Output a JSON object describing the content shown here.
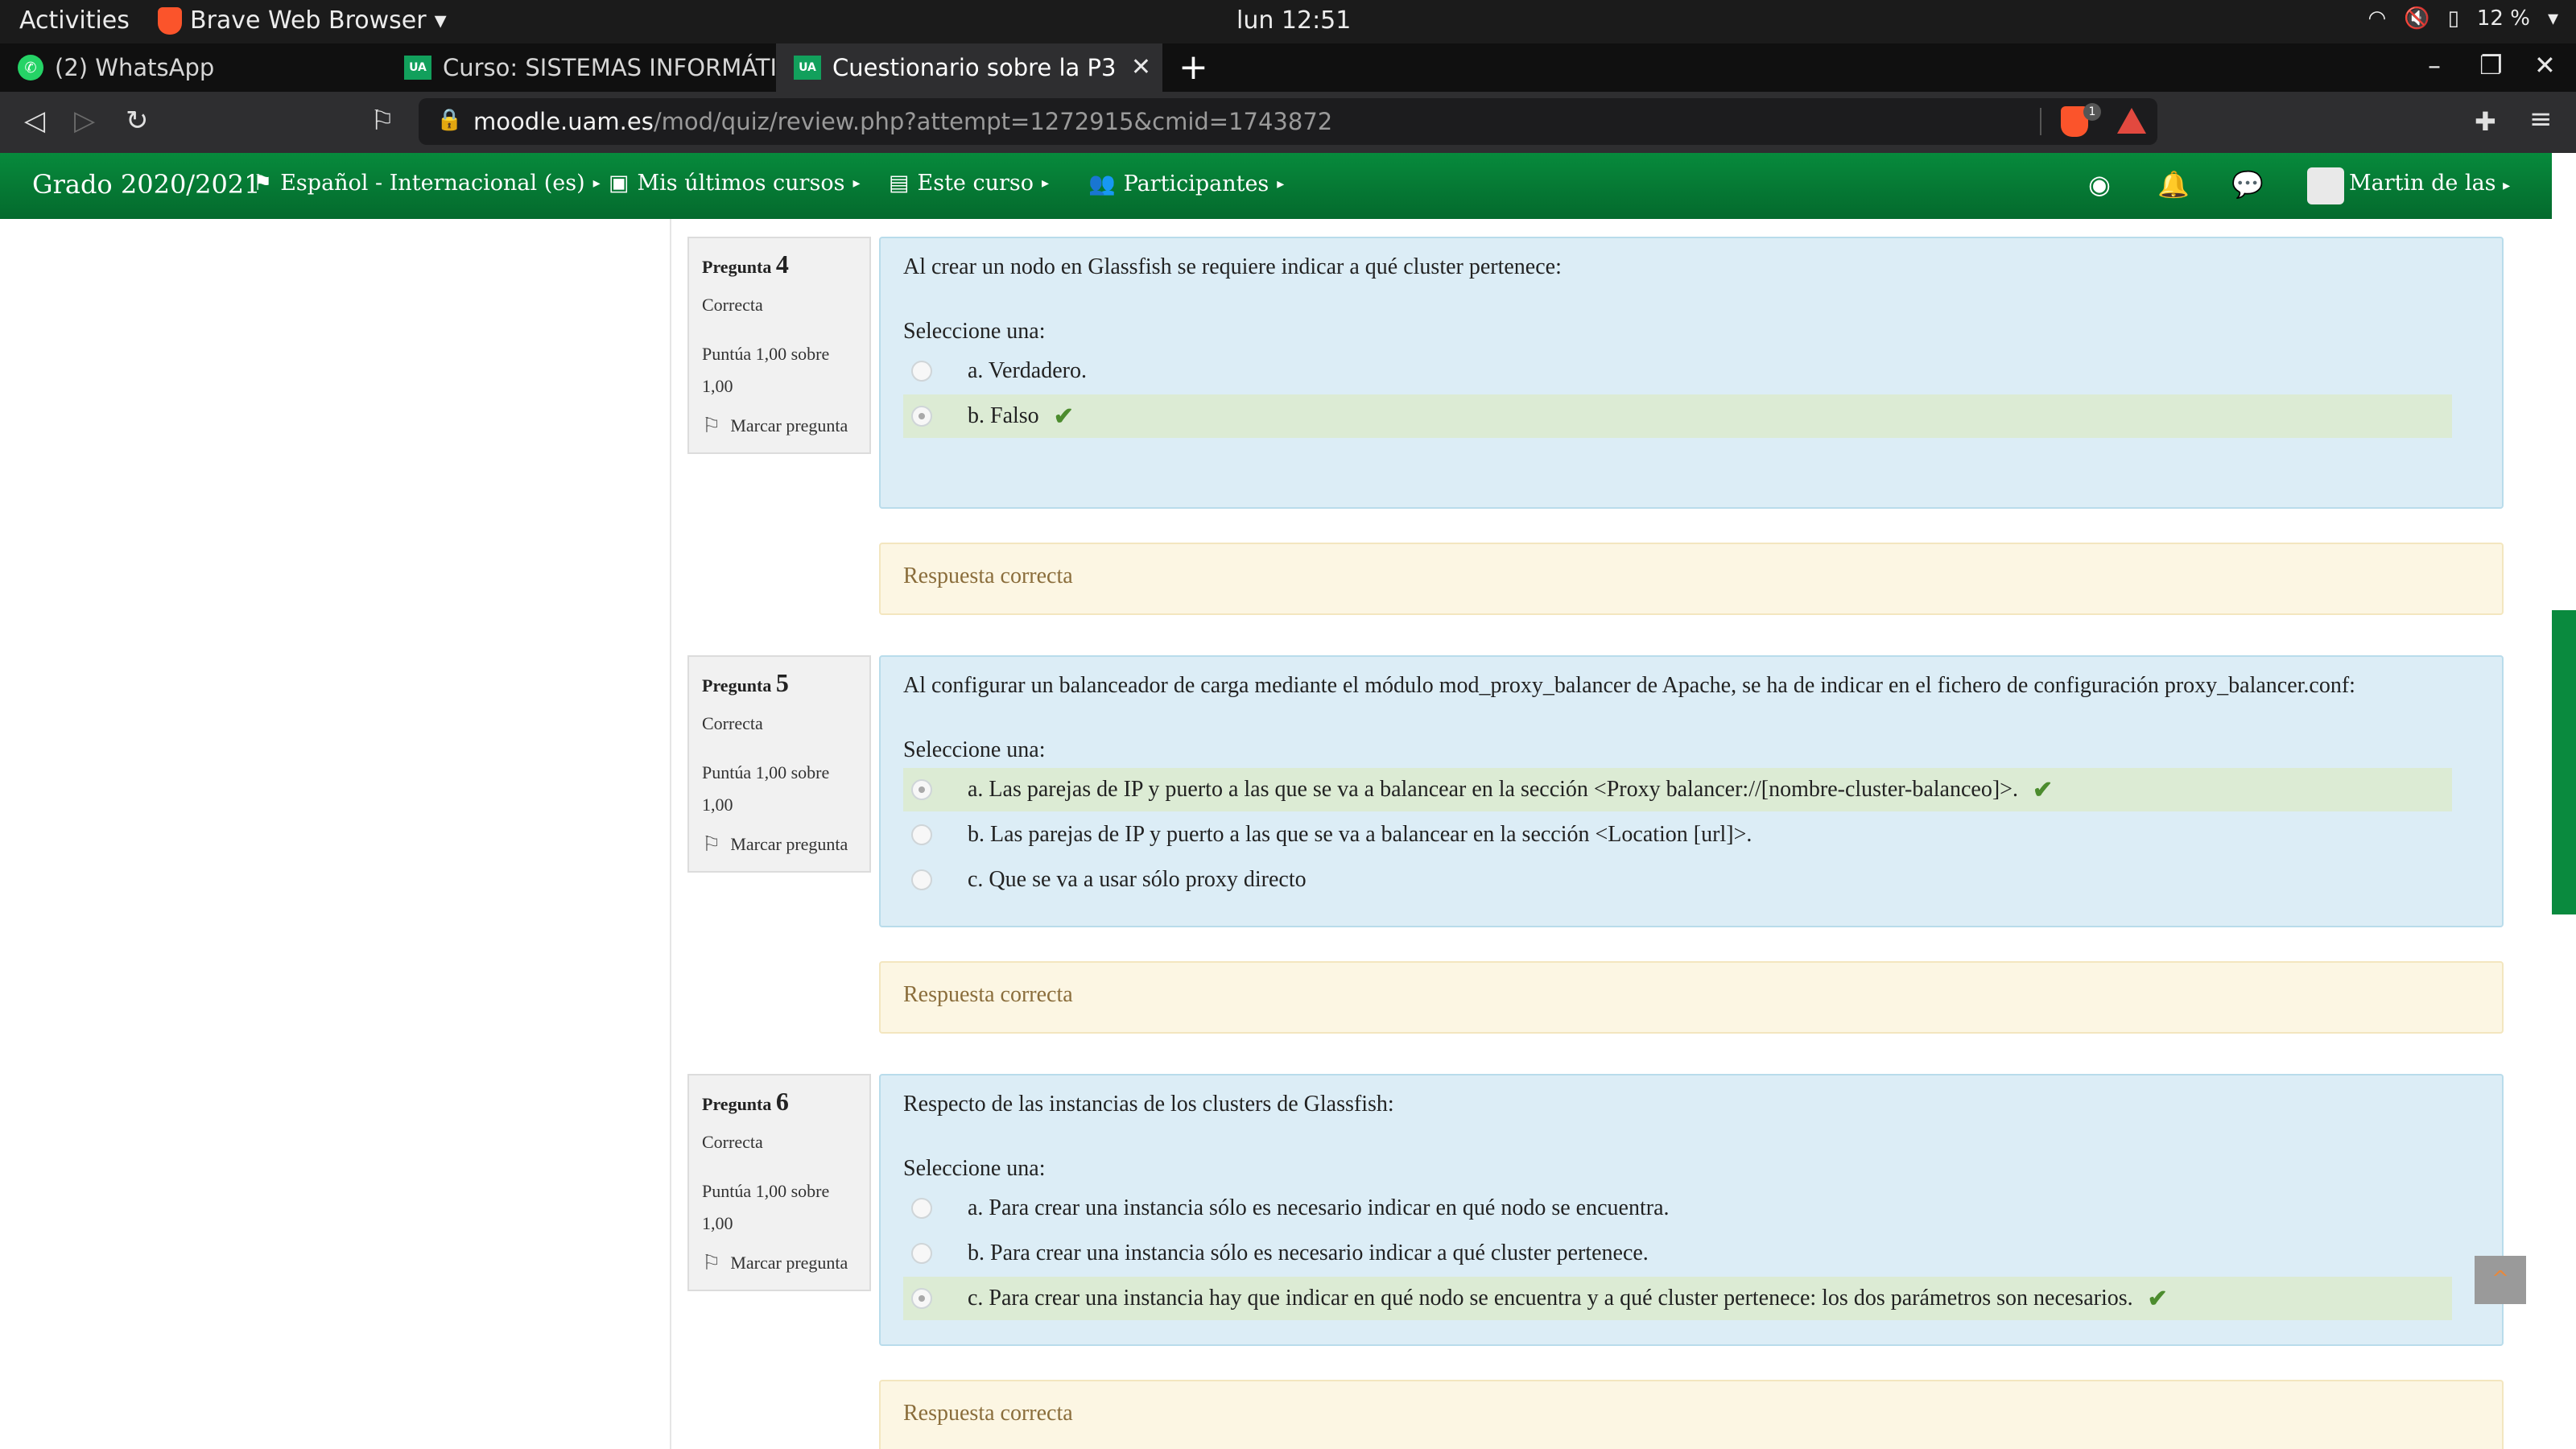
{
  "os": {
    "activities": "Activities",
    "app_name": "Brave Web Browser",
    "clock": "lun 12:51",
    "battery": "12 %"
  },
  "tabs": [
    {
      "label": "(2) WhatsApp"
    },
    {
      "label": "Curso: SISTEMAS INFORMÁTIC"
    },
    {
      "label": "Cuestionario sobre la P3"
    }
  ],
  "address": {
    "host": "moodle.uam.es",
    "path": "/mod/quiz/review.php?attempt=1272915&cmid=1743872",
    "shield_count": "1"
  },
  "moodle_nav": {
    "brand": "Grado 2020/2021",
    "items": [
      {
        "label": "Español - Internacional (es)",
        "icon": "flag-icon"
      },
      {
        "label": "Mis últimos cursos",
        "icon": "briefcase-icon"
      },
      {
        "label": "Este curso",
        "icon": "book-icon"
      },
      {
        "label": "Participantes",
        "icon": "users-icon"
      }
    ],
    "user": "Martin de las"
  },
  "questions": [
    {
      "label": "Pregunta",
      "number": "4",
      "state": "Correcta",
      "grade": "Puntúa 1,00 sobre 1,00",
      "flag": "Marcar pregunta",
      "text": "Al crear un nodo en Glassfish se requiere indicar a qué cluster pertenece:",
      "select_prompt": "Seleccione una:",
      "options": [
        {
          "text": "a. Verdadero.",
          "selected": false,
          "correct": false
        },
        {
          "text": "b. Falso",
          "selected": true,
          "correct": true
        }
      ],
      "feedback": "Respuesta correcta"
    },
    {
      "label": "Pregunta",
      "number": "5",
      "state": "Correcta",
      "grade": "Puntúa 1,00 sobre 1,00",
      "flag": "Marcar pregunta",
      "text": "Al configurar un balanceador de carga mediante el módulo mod_proxy_balancer de Apache, se ha de indicar en el fichero de configuración proxy_balancer.conf:",
      "select_prompt": "Seleccione una:",
      "options": [
        {
          "text": "a. Las parejas de IP y puerto a las que se va a balancear en la sección <Proxy balancer://[nombre-cluster-balanceo]>.",
          "selected": true,
          "correct": true
        },
        {
          "text": "b. Las parejas de IP y puerto a las que se va a balancear en la sección <Location [url]>.",
          "selected": false,
          "correct": false
        },
        {
          "text": "c. Que se va a usar sólo proxy directo",
          "selected": false,
          "correct": false
        }
      ],
      "feedback": "Respuesta correcta"
    },
    {
      "label": "Pregunta",
      "number": "6",
      "state": "Correcta",
      "grade": "Puntúa 1,00 sobre 1,00",
      "flag": "Marcar pregunta",
      "text": "Respecto de las instancias de los clusters de Glassfish:",
      "select_prompt": "Seleccione una:",
      "options": [
        {
          "text": "a. Para crear una instancia sólo es necesario indicar en qué nodo se encuentra.",
          "selected": false,
          "correct": false
        },
        {
          "text": "b. Para crear una instancia sólo es necesario indicar a qué cluster pertenece.",
          "selected": false,
          "correct": false
        },
        {
          "text": "c. Para crear una instancia hay que indicar en qué nodo se encuentra y a qué cluster pertenece: los dos parámetros son necesarios.",
          "selected": true,
          "correct": true
        }
      ],
      "feedback": "Respuesta correcta"
    }
  ],
  "colors": {
    "moodle_green": "#078a3c",
    "question_bg": "#dcedf6",
    "correct_bg": "#dcebd4",
    "feedback_bg": "#fcf6e3",
    "feedback_text": "#8a6d3b",
    "check": "#4c8c2e"
  }
}
